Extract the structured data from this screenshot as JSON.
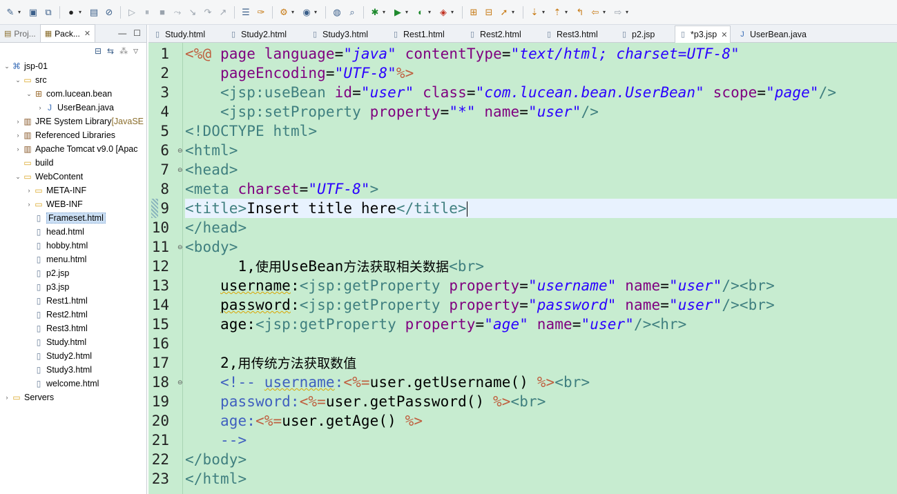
{
  "toolbar": {
    "icons": [
      "new-wizard-icon",
      "save-icon",
      "save-all-icon",
      "debug-perspective-icon",
      "open-console-icon",
      "skip-breakpoints-icon",
      "resume-icon",
      "suspend-icon",
      "terminate-icon",
      "disconnect-icon",
      "step-into-icon",
      "step-over-icon",
      "step-return-icon",
      "toggle-block-icon",
      "mark-occurrences-icon",
      "new-server-icon",
      "new-java-element-icon",
      "web-browser-icon",
      "search-icon",
      "debug-icon",
      "run-icon",
      "coverage-icon",
      "external-tools-icon",
      "open-type-icon",
      "open-task-icon",
      "open-resource-icon",
      "next-annotation-icon",
      "previous-annotation-icon",
      "last-edit-location-icon",
      "back-icon",
      "forward-icon"
    ]
  },
  "left_panel": {
    "tabs": [
      {
        "label": "Proj...",
        "active": false
      },
      {
        "label": "Pack...",
        "active": true,
        "close": "✕"
      }
    ],
    "window_buttons": {
      "minimize": "—",
      "maximize": "☐"
    },
    "tree": [
      {
        "label": "jsp-01",
        "extra": "",
        "depth": 0,
        "twisty": "⌄",
        "icon": "project-icon",
        "selected": false
      },
      {
        "label": "src",
        "extra": "",
        "depth": 1,
        "twisty": "⌄",
        "icon": "source-folder-icon",
        "selected": false
      },
      {
        "label": "com.lucean.bean",
        "extra": "",
        "depth": 2,
        "twisty": "⌄",
        "icon": "package-icon",
        "selected": false
      },
      {
        "label": "UserBean.java",
        "extra": "",
        "depth": 3,
        "twisty": "›",
        "icon": "java-file-icon",
        "selected": false
      },
      {
        "label": "JRE System Library ",
        "extra": "[JavaSE",
        "depth": 1,
        "twisty": "›",
        "icon": "library-icon",
        "selected": false
      },
      {
        "label": "Referenced Libraries",
        "extra": "",
        "depth": 1,
        "twisty": "›",
        "icon": "library-icon",
        "selected": false
      },
      {
        "label": "Apache Tomcat v9.0 [Apac",
        "extra": "",
        "depth": 1,
        "twisty": "›",
        "icon": "library-icon",
        "selected": false
      },
      {
        "label": "build",
        "extra": "",
        "depth": 1,
        "twisty": "",
        "icon": "folder-icon",
        "selected": false
      },
      {
        "label": "WebContent",
        "extra": "",
        "depth": 1,
        "twisty": "⌄",
        "icon": "folder-icon",
        "selected": false
      },
      {
        "label": "META-INF",
        "extra": "",
        "depth": 2,
        "twisty": "›",
        "icon": "folder-icon",
        "selected": false
      },
      {
        "label": "WEB-INF",
        "extra": "",
        "depth": 2,
        "twisty": "›",
        "icon": "folder-icon",
        "selected": false
      },
      {
        "label": "Frameset.html",
        "extra": "",
        "depth": 2,
        "twisty": "",
        "icon": "html-file-icon",
        "selected": true
      },
      {
        "label": "head.html",
        "extra": "",
        "depth": 2,
        "twisty": "",
        "icon": "html-file-icon",
        "selected": false
      },
      {
        "label": "hobby.html",
        "extra": "",
        "depth": 2,
        "twisty": "",
        "icon": "html-file-icon",
        "selected": false
      },
      {
        "label": "menu.html",
        "extra": "",
        "depth": 2,
        "twisty": "",
        "icon": "html-file-icon",
        "selected": false
      },
      {
        "label": "p2.jsp",
        "extra": "",
        "depth": 2,
        "twisty": "",
        "icon": "jsp-file-icon",
        "selected": false
      },
      {
        "label": "p3.jsp",
        "extra": "",
        "depth": 2,
        "twisty": "",
        "icon": "jsp-file-icon",
        "selected": false
      },
      {
        "label": "Rest1.html",
        "extra": "",
        "depth": 2,
        "twisty": "",
        "icon": "html-file-icon",
        "selected": false
      },
      {
        "label": "Rest2.html",
        "extra": "",
        "depth": 2,
        "twisty": "",
        "icon": "html-file-icon",
        "selected": false
      },
      {
        "label": "Rest3.html",
        "extra": "",
        "depth": 2,
        "twisty": "",
        "icon": "html-file-icon",
        "selected": false
      },
      {
        "label": "Study.html",
        "extra": "",
        "depth": 2,
        "twisty": "",
        "icon": "html-file-icon",
        "selected": false
      },
      {
        "label": "Study2.html",
        "extra": "",
        "depth": 2,
        "twisty": "",
        "icon": "html-file-icon",
        "selected": false
      },
      {
        "label": "Study3.html",
        "extra": "",
        "depth": 2,
        "twisty": "",
        "icon": "html-file-icon",
        "selected": false
      },
      {
        "label": "welcome.html",
        "extra": "",
        "depth": 2,
        "twisty": "",
        "icon": "html-file-icon",
        "selected": false
      },
      {
        "label": "Servers",
        "extra": "",
        "depth": 0,
        "twisty": "›",
        "icon": "folder-icon",
        "selected": false
      }
    ]
  },
  "editor": {
    "tabs": [
      {
        "label": "Study.html",
        "active": false,
        "icon": "html-file-icon"
      },
      {
        "label": "Study2.html",
        "active": false,
        "icon": "html-file-icon"
      },
      {
        "label": "Study3.html",
        "active": false,
        "icon": "html-file-icon"
      },
      {
        "label": "Rest1.html",
        "active": false,
        "icon": "html-file-icon"
      },
      {
        "label": "Rest2.html",
        "active": false,
        "icon": "html-file-icon"
      },
      {
        "label": "Rest3.html",
        "active": false,
        "icon": "html-file-icon"
      },
      {
        "label": "p2.jsp",
        "active": false,
        "icon": "jsp-file-icon"
      },
      {
        "label": "*p3.jsp",
        "active": true,
        "icon": "jsp-file-icon",
        "close": "✕"
      },
      {
        "label": "UserBean.java",
        "active": false,
        "icon": "java-file-icon"
      }
    ],
    "current_line": 9,
    "background_color": "#c7ecd0",
    "lines": [
      {
        "n": "1",
        "fold": "",
        "tokens": [
          [
            "k-delim",
            "<%@"
          ],
          [
            "k-txt",
            " "
          ],
          [
            "k-attr",
            "page"
          ],
          [
            "k-txt",
            " "
          ],
          [
            "k-attr",
            "language"
          ],
          [
            "k-txt",
            "="
          ],
          [
            "k-val",
            "\"java\""
          ],
          [
            "k-txt",
            " "
          ],
          [
            "k-attr",
            "contentType"
          ],
          [
            "k-txt",
            "="
          ],
          [
            "k-val",
            "\"text/html; charset=UTF-8\""
          ]
        ]
      },
      {
        "n": "2",
        "fold": "",
        "tokens": [
          [
            "k-txt",
            "    "
          ],
          [
            "k-attr",
            "pageEncoding"
          ],
          [
            "k-txt",
            "="
          ],
          [
            "k-val",
            "\"UTF-8\""
          ],
          [
            "k-delim",
            "%>"
          ]
        ]
      },
      {
        "n": "3",
        "fold": "",
        "tokens": [
          [
            "k-txt",
            "    "
          ],
          [
            "k-tag",
            "<jsp:useBean"
          ],
          [
            "k-txt",
            " "
          ],
          [
            "k-attr",
            "id"
          ],
          [
            "k-txt",
            "="
          ],
          [
            "k-val",
            "\"user\""
          ],
          [
            "k-txt",
            " "
          ],
          [
            "k-attr",
            "class"
          ],
          [
            "k-txt",
            "="
          ],
          [
            "k-val",
            "\"com.lucean.bean.UserBean\""
          ],
          [
            "k-txt",
            " "
          ],
          [
            "k-attr",
            "scope"
          ],
          [
            "k-txt",
            "="
          ],
          [
            "k-val",
            "\"page\""
          ],
          [
            "k-tag",
            "/>"
          ]
        ]
      },
      {
        "n": "4",
        "fold": "",
        "tokens": [
          [
            "k-txt",
            "    "
          ],
          [
            "k-tag",
            "<jsp:setProperty"
          ],
          [
            "k-txt",
            " "
          ],
          [
            "k-attr",
            "property"
          ],
          [
            "k-txt",
            "="
          ],
          [
            "k-val",
            "\"*\""
          ],
          [
            "k-txt",
            " "
          ],
          [
            "k-attr",
            "name"
          ],
          [
            "k-txt",
            "="
          ],
          [
            "k-val",
            "\"user\""
          ],
          [
            "k-tag",
            "/>"
          ]
        ]
      },
      {
        "n": "5",
        "fold": "",
        "tokens": [
          [
            "k-doc",
            "<!DOCTYPE"
          ],
          [
            "k-txt",
            " "
          ],
          [
            "k-doc",
            "html"
          ],
          [
            "k-doc",
            ">"
          ]
        ]
      },
      {
        "n": "6",
        "fold": "⊖",
        "tokens": [
          [
            "k-tag",
            "<html>"
          ]
        ]
      },
      {
        "n": "7",
        "fold": "⊖",
        "tokens": [
          [
            "k-tag",
            "<head>"
          ]
        ]
      },
      {
        "n": "8",
        "fold": "",
        "tokens": [
          [
            "k-tag",
            "<meta"
          ],
          [
            "k-txt",
            " "
          ],
          [
            "k-attr",
            "charset"
          ],
          [
            "k-txt",
            "="
          ],
          [
            "k-val",
            "\"UTF-8\""
          ],
          [
            "k-tag",
            ">"
          ]
        ]
      },
      {
        "n": "9",
        "fold": "",
        "tokens": [
          [
            "k-tag",
            "<title>"
          ],
          [
            "k-txt",
            "Insert title here"
          ],
          [
            "k-tag",
            "</title>"
          ]
        ]
      },
      {
        "n": "10",
        "fold": "",
        "tokens": [
          [
            "k-tag",
            "</head>"
          ]
        ]
      },
      {
        "n": "11",
        "fold": "⊖",
        "tokens": [
          [
            "k-tag",
            "<body>"
          ]
        ]
      },
      {
        "n": "12",
        "fold": "",
        "tokens": [
          [
            "k-txt",
            "      1,"
          ],
          [
            "k-txt cjk",
            "使用"
          ],
          [
            "k-txt",
            "UseBean"
          ],
          [
            "k-txt cjk",
            "方法获取相关数据"
          ],
          [
            "k-tag",
            "<br>"
          ]
        ]
      },
      {
        "n": "13",
        "fold": "",
        "tokens": [
          [
            "k-txt",
            "    "
          ],
          [
            "k-txt k-ul",
            "username"
          ],
          [
            "k-txt",
            ":"
          ],
          [
            "k-tag",
            "<jsp:getProperty"
          ],
          [
            "k-txt",
            " "
          ],
          [
            "k-attr",
            "property"
          ],
          [
            "k-txt",
            "="
          ],
          [
            "k-val",
            "\"username\""
          ],
          [
            "k-txt",
            " "
          ],
          [
            "k-attr",
            "name"
          ],
          [
            "k-txt",
            "="
          ],
          [
            "k-val",
            "\"user\""
          ],
          [
            "k-tag",
            "/><br>"
          ]
        ]
      },
      {
        "n": "14",
        "fold": "",
        "tokens": [
          [
            "k-txt",
            "    "
          ],
          [
            "k-txt k-ul",
            "password"
          ],
          [
            "k-txt",
            ":"
          ],
          [
            "k-tag",
            "<jsp:getProperty"
          ],
          [
            "k-txt",
            " "
          ],
          [
            "k-attr",
            "property"
          ],
          [
            "k-txt",
            "="
          ],
          [
            "k-val",
            "\"password\""
          ],
          [
            "k-txt",
            " "
          ],
          [
            "k-attr",
            "name"
          ],
          [
            "k-txt",
            "="
          ],
          [
            "k-val",
            "\"user\""
          ],
          [
            "k-tag",
            "/><br>"
          ]
        ]
      },
      {
        "n": "15",
        "fold": "",
        "tokens": [
          [
            "k-txt",
            "    age:"
          ],
          [
            "k-tag",
            "<jsp:getProperty"
          ],
          [
            "k-txt",
            " "
          ],
          [
            "k-attr",
            "property"
          ],
          [
            "k-txt",
            "="
          ],
          [
            "k-val",
            "\"age\""
          ],
          [
            "k-txt",
            " "
          ],
          [
            "k-attr",
            "name"
          ],
          [
            "k-txt",
            "="
          ],
          [
            "k-val",
            "\"user\""
          ],
          [
            "k-tag",
            "/><hr>"
          ]
        ]
      },
      {
        "n": "16",
        "fold": "",
        "tokens": []
      },
      {
        "n": "17",
        "fold": "",
        "tokens": [
          [
            "k-txt",
            "    2,"
          ],
          [
            "k-txt cjk",
            "用传统方法获取数值"
          ]
        ]
      },
      {
        "n": "18",
        "fold": "⊖",
        "tokens": [
          [
            "k-txt",
            "    "
          ],
          [
            "k-com",
            "<!-- "
          ],
          [
            "k-com k-ul",
            "username"
          ],
          [
            "k-com",
            ":"
          ],
          [
            "k-delim",
            "<%="
          ],
          [
            "k-txt",
            "user.getUsername() "
          ],
          [
            "k-delim",
            "%>"
          ],
          [
            "k-tag",
            "<br>"
          ]
        ]
      },
      {
        "n": "19",
        "fold": "",
        "tokens": [
          [
            "k-txt",
            "    "
          ],
          [
            "k-com",
            "password:"
          ],
          [
            "k-delim",
            "<%="
          ],
          [
            "k-txt",
            "user.getPassword() "
          ],
          [
            "k-delim",
            "%>"
          ],
          [
            "k-tag",
            "<br>"
          ]
        ]
      },
      {
        "n": "20",
        "fold": "",
        "tokens": [
          [
            "k-txt",
            "    "
          ],
          [
            "k-com",
            "age:"
          ],
          [
            "k-delim",
            "<%="
          ],
          [
            "k-txt",
            "user.getAge() "
          ],
          [
            "k-delim",
            "%>"
          ]
        ]
      },
      {
        "n": "21",
        "fold": "",
        "tokens": [
          [
            "k-txt",
            "    "
          ],
          [
            "k-com",
            "-->"
          ]
        ]
      },
      {
        "n": "22",
        "fold": "",
        "tokens": [
          [
            "k-tag",
            "</body>"
          ]
        ]
      },
      {
        "n": "23",
        "fold": "",
        "tokens": [
          [
            "k-tag",
            "</html>"
          ]
        ]
      }
    ]
  }
}
